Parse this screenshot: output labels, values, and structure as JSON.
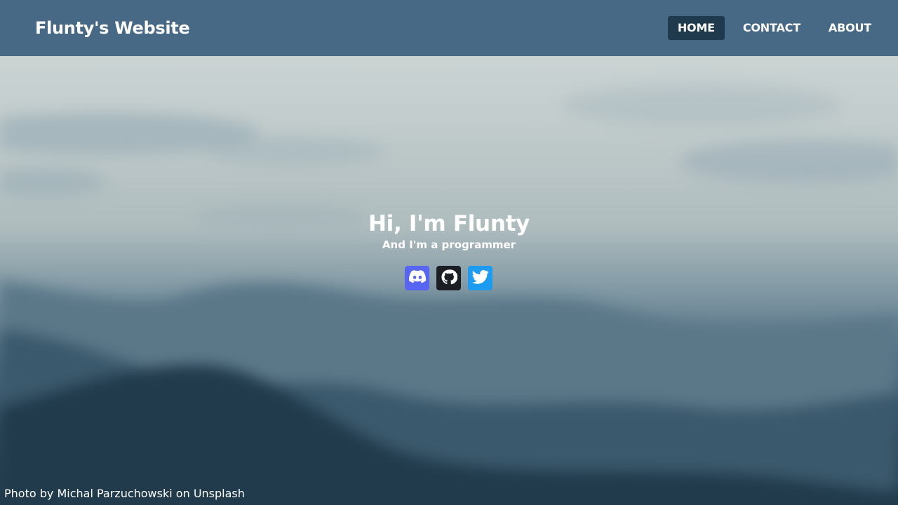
{
  "brand": {
    "title": "Flunty's Website"
  },
  "nav": {
    "items": [
      {
        "label": "HOME",
        "active": true
      },
      {
        "label": "CONTACT",
        "active": false
      },
      {
        "label": "ABOUT",
        "active": false
      }
    ]
  },
  "hero": {
    "title": "Hi, I'm Flunty",
    "subtitle": "And I'm a programmer"
  },
  "socials": [
    {
      "icon": "discord-icon",
      "color": "#5865f2"
    },
    {
      "icon": "github-icon",
      "color": "#1b1f23"
    },
    {
      "icon": "twitter-icon",
      "color": "#1d9bf0"
    }
  ],
  "credit": {
    "prefix": "Photo by",
    "author": "Michal Parzuchowski",
    "middle": "on",
    "site": "Unsplash"
  },
  "colors": {
    "navbar": "#3d5f7e",
    "nav_active": "#1f3a4d"
  }
}
